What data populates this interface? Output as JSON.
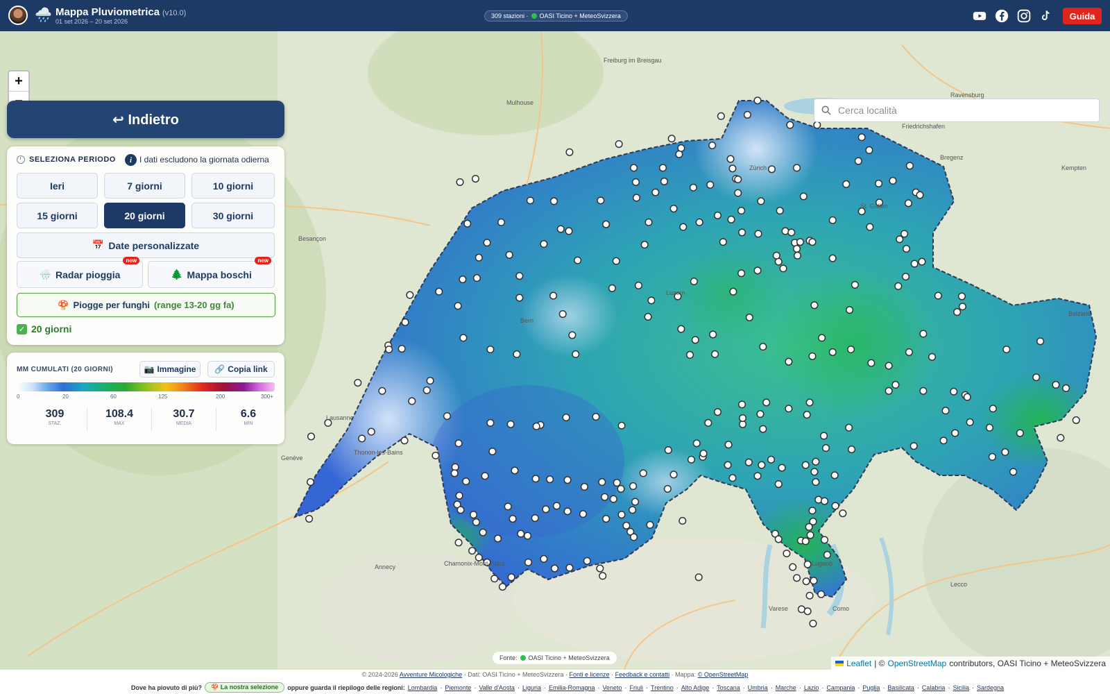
{
  "header": {
    "title": "Mappa Pluviometrica",
    "version": "(v10.0)",
    "dates": "01 set 2026 – 20 set 2026",
    "stations_pill": "309 stazioni · ",
    "stations_source": "OASI Ticino + MeteoSvizzera",
    "guide_label": "Guida",
    "social_icons": [
      "youtube-icon",
      "facebook-icon",
      "instagram-icon",
      "tiktok-icon"
    ]
  },
  "map": {
    "zoom_in": "+",
    "zoom_out": "−",
    "search_placeholder": "Cerca località",
    "city_labels": [
      "Besançon",
      "Mulhouse",
      "Freiburg im Breisgau",
      "Zürich",
      "Bern",
      "Genève",
      "Lausanne",
      "Luzern",
      "St. Gallen",
      "Lugano",
      "Como",
      "Varese",
      "Annecy",
      "Chamonix-Mont-Blanc",
      "Thonon-les-Bains",
      "Bolzano",
      "Lecco",
      "Ravensburg",
      "Friedrichshafen",
      "Kempten",
      "Bregenz"
    ],
    "source_pill": "OASI Ticino + MeteoSvizzera",
    "source_prefix": "Fonte:",
    "attribution_leaflet": "Leaflet",
    "attribution_osm": "OpenStreetMap",
    "attribution_rest": "contributors, OASI Ticino + MeteoSvizzera"
  },
  "panel": {
    "back_label": "↩ Indietro",
    "period_title": "SELEZIONA PERIODO",
    "period_note": "I dati escludono la giornata odierna",
    "periods": [
      "Ieri",
      "7 giorni",
      "10 giorni",
      "15 giorni",
      "20 giorni",
      "30 giorni"
    ],
    "active_period": "20 giorni",
    "custom_dates": "Date personalizzate",
    "radar": "Radar pioggia",
    "woods": "Mappa boschi",
    "new_badge": "new",
    "funghi_label": "Piogge per funghi",
    "funghi_range": "(range 13-20 gg fa)",
    "selected": "20 giorni"
  },
  "legend": {
    "title": "MM CUMULATI (20 GIORNI)",
    "image_btn": "Immagine",
    "link_btn": "Copia link",
    "ticks": [
      "0",
      "20",
      "60",
      "125",
      "200",
      "300+"
    ],
    "stats": [
      {
        "value": "309",
        "label": "STAZ."
      },
      {
        "value": "108.4",
        "label": "MAX"
      },
      {
        "value": "30.7",
        "label": "MEDIA"
      },
      {
        "value": "6.6",
        "label": "MIN"
      }
    ]
  },
  "footer": {
    "copyright": "© 2024-2026",
    "site": "Avventure Micologiche",
    "data_note": "· Dati: OASI Ticino + MeteoSvizzera ·",
    "sources": "Fonti e licenze",
    "feedback": "Feedback e contatti",
    "map_note": "· Mappa:",
    "osm": "© OpenStreetMap",
    "where_label": "Dove ha piovuto di più?",
    "selection": "La nostra selezione",
    "regions_label": "oppure guarda il riepilogo delle regioni:",
    "regions": [
      "Lombardia",
      "Piemonte",
      "Valle d'Aosta",
      "Liguria",
      "Emilia-Romagna",
      "Veneto",
      "Friuli",
      "Trentino",
      "Alto Adige",
      "Toscana",
      "Umbria",
      "Marche",
      "Lazio",
      "Campania",
      "Puglia",
      "Basilicata",
      "Calabria",
      "Sicilia",
      "Sardegna"
    ]
  }
}
